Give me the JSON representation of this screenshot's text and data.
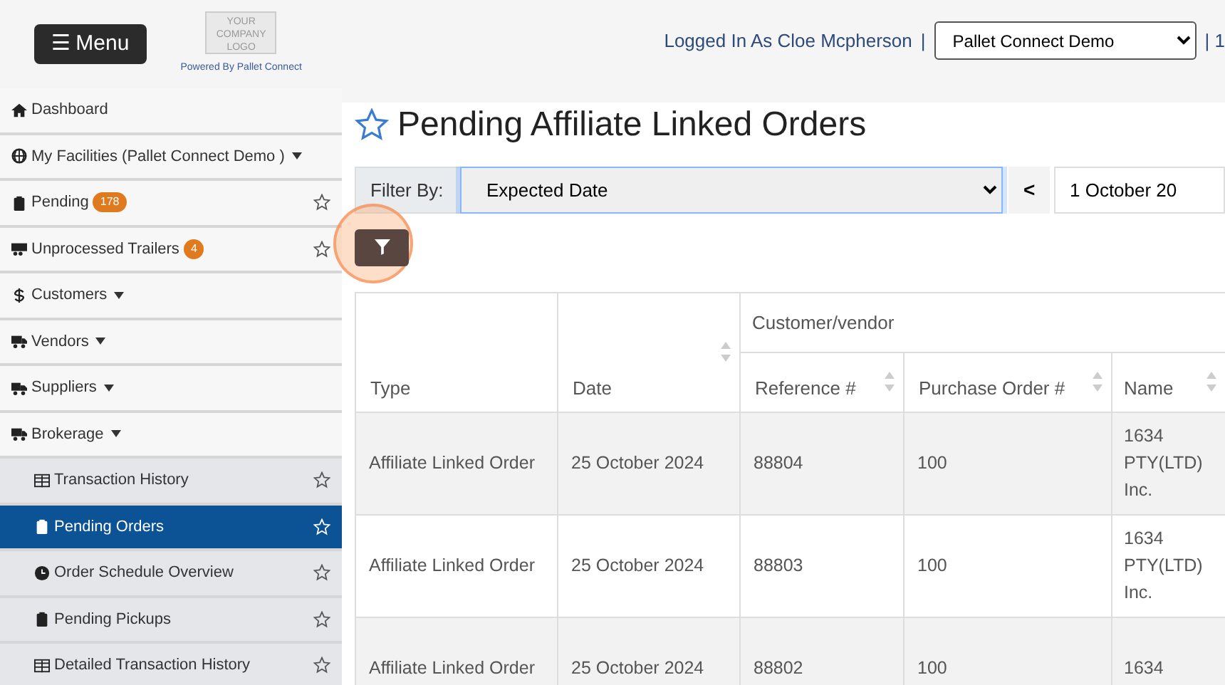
{
  "header": {
    "menu_button": "☰ Menu",
    "logo_text": "YOUR COMPANY LOGO",
    "powered_by": "Powered By Pallet Connect",
    "user_text": "Logged In As Cloe Mcpherson",
    "separator": "|",
    "facility_select": "Pallet Connect Demo",
    "trailing_text": "| 1"
  },
  "sidebar": {
    "items": [
      {
        "label": "Dashboard",
        "dropdown": false,
        "favorite_star": false,
        "selected": false
      },
      {
        "label": "My Facilities (Pallet Connect Demo )",
        "dropdown": true,
        "favorite_star": false,
        "selected": false
      },
      {
        "label": "Pending",
        "badge": "178",
        "dropdown": false,
        "favorite_star": true,
        "selected": false
      },
      {
        "label": "Unprocessed Trailers",
        "badge": "4",
        "dropdown": false,
        "favorite_star": true,
        "selected": false
      },
      {
        "label": "Customers",
        "dropdown": true,
        "favorite_star": false,
        "selected": false
      },
      {
        "label": "Vendors",
        "dropdown": true,
        "favorite_star": false,
        "selected": false
      },
      {
        "label": "Suppliers",
        "dropdown": true,
        "favorite_star": false,
        "selected": false
      },
      {
        "label": "Brokerage",
        "dropdown": true,
        "favorite_star": false,
        "selected": false,
        "expanded": true,
        "children": [
          {
            "label": "Transaction History",
            "favorite_star": true,
            "selected": false
          },
          {
            "label": "Pending Orders",
            "favorite_star": true,
            "selected": true
          },
          {
            "label": "Order Schedule Overview",
            "favorite_star": true,
            "selected": false
          },
          {
            "label": "Pending Pickups",
            "favorite_star": true,
            "selected": false
          },
          {
            "label": "Detailed Transaction History",
            "favorite_star": true,
            "selected": false
          }
        ]
      }
    ]
  },
  "page": {
    "title": "Pending Affiliate Linked Orders",
    "filter": {
      "label": "Filter By:",
      "value": "Expected Date",
      "prev_button": "<",
      "date_value": "1 October 20"
    },
    "table": {
      "group_header": "Customer/vendor",
      "columns": [
        "Type",
        "Date",
        "Reference #",
        "Purchase Order #",
        "Name"
      ],
      "rows": [
        [
          "Affiliate Linked Order",
          "25 October 2024",
          "88804",
          "100",
          "1634 PTY(LTD) Inc."
        ],
        [
          "Affiliate Linked Order",
          "25 October 2024",
          "88803",
          "100",
          "1634 PTY(LTD) Inc."
        ],
        [
          "Affiliate Linked Order",
          "25 October 2024",
          "88802",
          "100",
          "1634"
        ]
      ]
    }
  }
}
